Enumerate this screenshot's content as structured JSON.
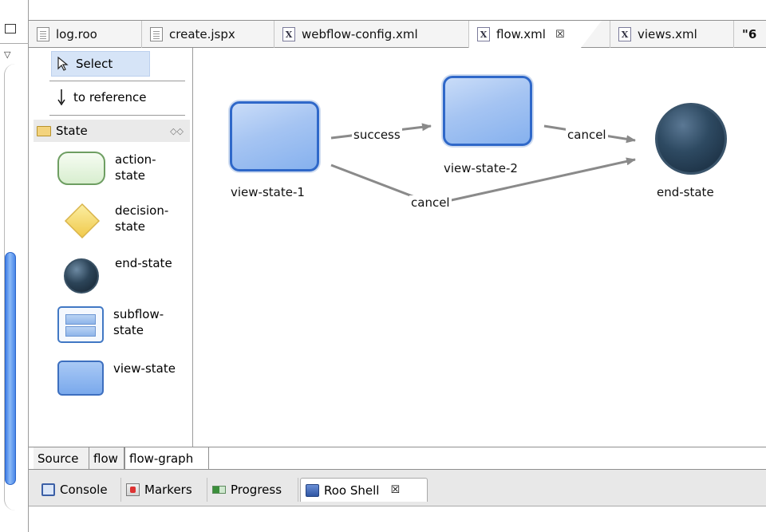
{
  "editor_tabs": [
    {
      "label": "log.roo",
      "icon": "text-file-icon"
    },
    {
      "label": "create.jspx",
      "icon": "text-file-icon"
    },
    {
      "label": "webflow-config.xml",
      "icon": "xml-file-icon"
    },
    {
      "label": "flow.xml",
      "icon": "xml-file-icon",
      "active": true,
      "close": "☒"
    },
    {
      "label": "views.xml",
      "icon": "xml-file-icon"
    },
    {
      "label": "\"6",
      "icon": "overflow-icon"
    }
  ],
  "palette": {
    "select_label": "Select",
    "reference_label": "to reference",
    "drawer_label": "State",
    "entries": [
      {
        "label": "action-\nstate",
        "shape": "action-state"
      },
      {
        "label": "decision-\nstate",
        "shape": "decision-state"
      },
      {
        "label": "end-state",
        "shape": "end-state"
      },
      {
        "label": "subflow-\nstate",
        "shape": "subflow-state"
      },
      {
        "label": "view-state",
        "shape": "view-state"
      }
    ]
  },
  "graph": {
    "nodes": {
      "view_state_1": "view-state-1",
      "view_state_2": "view-state-2",
      "end_state": "end-state"
    },
    "edges": {
      "success": "success",
      "cancel_top": "cancel",
      "cancel_bottom": "cancel"
    }
  },
  "page_tabs": {
    "source": "Source",
    "flow": "flow",
    "flow_graph": "flow-graph"
  },
  "view_tabs": {
    "console": "Console",
    "markers": "Markers",
    "progress": "Progress",
    "roo_shell": "Roo Shell",
    "close": "☒"
  },
  "colors": {
    "view_state": "#86b1ee",
    "end_state": "#2e4a62",
    "action_state": "#d8eecf",
    "decision_state": "#f5d96a",
    "edge": "#8a8a8a",
    "scrollbar": "#4a87e8"
  }
}
